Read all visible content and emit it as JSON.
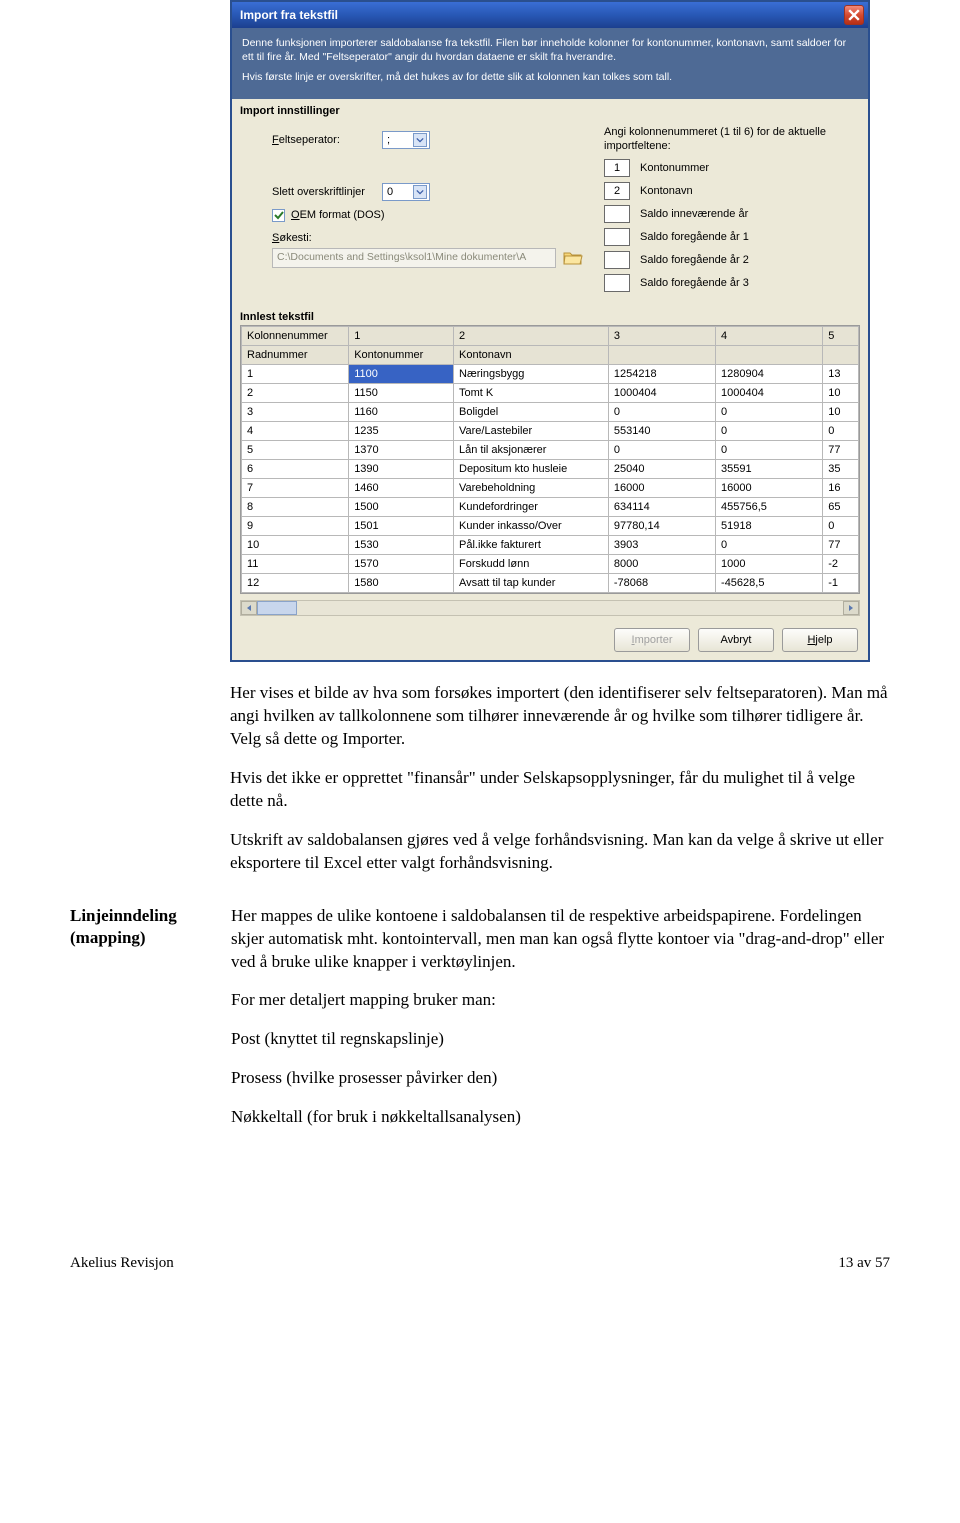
{
  "dialog": {
    "title": "Import fra tekstfil",
    "intro_p1": "Denne funksjonen importerer saldobalanse fra tekstfil. Filen bør inneholde kolonner for kontonummer, kontonavn, samt saldoer for ett til fire år. Med \"Feltseperator\" angir du hvordan dataene er skilt fra hverandre.",
    "intro_p2": "Hvis første linje er overskrifter, må det hukes av for dette slik at kolonnen kan tolkes som tall.",
    "section_import": "Import innstillinger",
    "label_feltsep_pre": "F",
    "label_feltsep": "eltseperator:",
    "feltsep_value": ";",
    "label_slett": "Slett overskriftlinjer",
    "slett_value": "0",
    "chk_oem_pre": "O",
    "chk_oem": "EM format (DOS)",
    "label_sokesti_pre": "S",
    "label_sokesti": "økesti:",
    "sokesti_value": "C:\\Documents and Settings\\ksol1\\Mine dokumenter\\A",
    "right_label": "Angi kolonnenummeret (1 til 6) for de aktuelle importfeltene:",
    "col_maps": [
      {
        "num": "1",
        "label": "Kontonummer"
      },
      {
        "num": "2",
        "label": "Kontonavn"
      },
      {
        "num": "",
        "label": "Saldo inneværende år"
      },
      {
        "num": "",
        "label": "Saldo foregående år 1"
      },
      {
        "num": "",
        "label": "Saldo foregående år 2"
      },
      {
        "num": "",
        "label": "Saldo foregående år 3"
      }
    ],
    "section_innlest": "Innlest tekstfil",
    "col_header": [
      "Kolonnenummer",
      "1",
      "2",
      "3",
      "4",
      "5"
    ],
    "rad_header": [
      "Radnummer",
      "Kontonummer",
      "Kontonavn",
      "",
      "",
      ""
    ],
    "rows": [
      [
        "1",
        "1100",
        "Næringsbygg",
        "1254218",
        "1280904",
        "13"
      ],
      [
        "2",
        "1150",
        "Tomt K",
        "1000404",
        "1000404",
        "10"
      ],
      [
        "3",
        "1160",
        "Boligdel",
        "0",
        "0",
        "10"
      ],
      [
        "4",
        "1235",
        "Vare/Lastebiler",
        "553140",
        "0",
        "0"
      ],
      [
        "5",
        "1370",
        "Lån til aksjonærer",
        "0",
        "0",
        "77"
      ],
      [
        "6",
        "1390",
        "Depositum kto husleie",
        "25040",
        "35591",
        "35"
      ],
      [
        "7",
        "1460",
        "Varebeholdning",
        "16000",
        "16000",
        "16"
      ],
      [
        "8",
        "1500",
        "Kundefordringer",
        "634114",
        "455756,5",
        "65"
      ],
      [
        "9",
        "1501",
        "Kunder inkasso/Over",
        "97780,14",
        "51918",
        "0"
      ],
      [
        "10",
        "1530",
        "Pål.ikke fakturert",
        "3903",
        "0",
        "77"
      ],
      [
        "11",
        "1570",
        "Forskudd lønn",
        "8000",
        "1000",
        "-2"
      ],
      [
        "12",
        "1580",
        "Avsatt til tap kunder",
        "-78068",
        "-45628,5",
        "-1"
      ]
    ],
    "btn_importer_pre": "I",
    "btn_importer": "mporter",
    "btn_avbryt": "Avbryt",
    "btn_hjelp_pre": "H",
    "btn_hjelp": "jelp"
  },
  "doc": {
    "p1": "Her vises et bilde av hva som forsøkes importert (den identifiserer selv feltseparatoren). Man må angi hvilken av tallkolonnene som tilhører inneværende år og hvilke som tilhører tidligere år. Velg så dette og Importer.",
    "p2": "Hvis det ikke er opprettet \"finansår\" under Selskapsopplysninger, får du mulighet til å velge dette nå.",
    "p3": "Utskrift av saldobalansen gjøres ved å velge forhåndsvisning. Man kan da velge å skrive ut eller eksportere til Excel etter valgt forhåndsvisning.",
    "side_heading": "Linjeinndeling (mapping)",
    "c1": "Her mappes de ulike kontoene i saldobalansen til de respektive arbeidspapirene. Fordelingen skjer automatisk mht. kontointervall, men man kan også flytte kontoer via \"drag-and-drop\" eller ved å bruke ulike knapper i verktøylinjen.",
    "c2": "For mer detaljert mapping bruker man:",
    "c3": "Post (knyttet til regnskapslinje)",
    "c4": "Prosess (hvilke prosesser påvirker den)",
    "c5": "Nøkkeltall (for bruk i nøkkeltallsanalysen)"
  },
  "footer": {
    "left": "Akelius Revisjon",
    "right": "13 av 57"
  }
}
